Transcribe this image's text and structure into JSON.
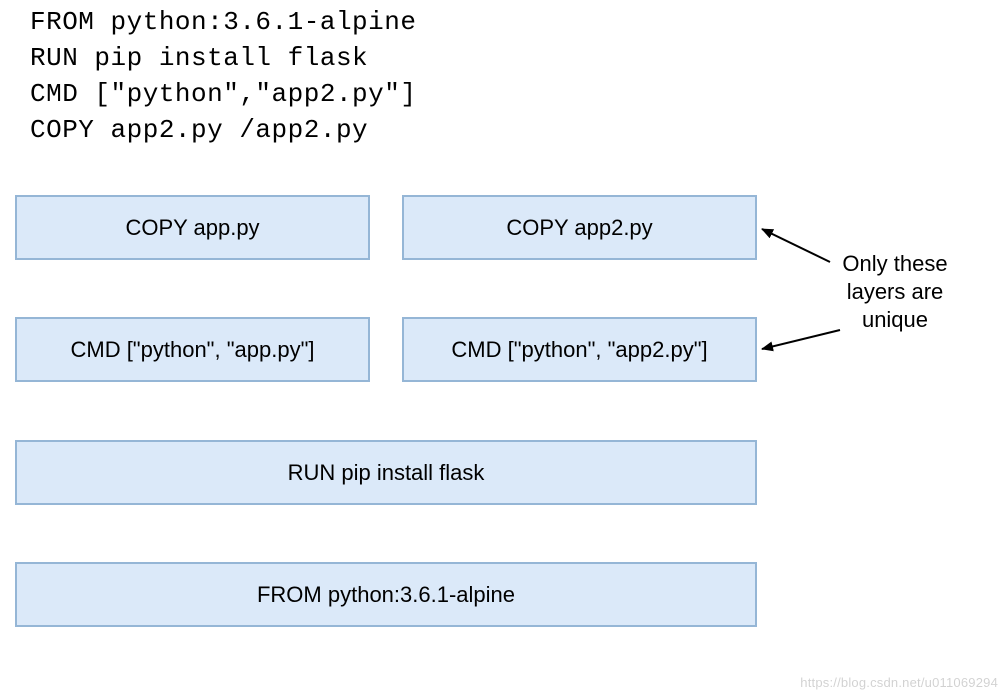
{
  "code": {
    "line1": "FROM python:3.6.1-alpine",
    "line2": "RUN pip install flask",
    "line3": "CMD [\"python\",\"app2.py\"]",
    "line4": "COPY app2.py /app2.py"
  },
  "layers": {
    "topLeft": "COPY app.py",
    "topRight": "COPY app2.py",
    "midLeft": "CMD [\"python\", \"app.py\"]",
    "midRight": "CMD [\"python\", \"app2.py\"]",
    "run": "RUN pip install flask",
    "from": "FROM python:3.6.1-alpine"
  },
  "annotation": {
    "line1": "Only these",
    "line2": "layers are",
    "line3": "unique"
  },
  "watermark": "https://blog.csdn.net/u011069294",
  "colors": {
    "boxFill": "#dbe9f9",
    "boxBorder": "#95b6d6"
  }
}
